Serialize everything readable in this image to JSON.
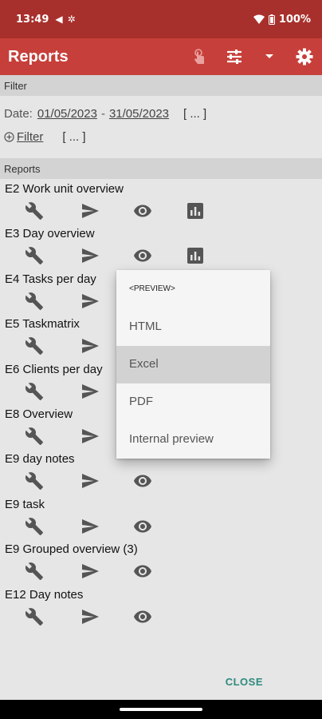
{
  "status_bar": {
    "time": "13:49",
    "battery": "100%"
  },
  "app_bar": {
    "title": "Reports"
  },
  "filter_section": {
    "header": "Filter",
    "date_label": "Date:",
    "date_from": "01/05/2023",
    "separator": "-",
    "date_to": "31/05/2023",
    "date_more": "[ ... ]",
    "filter_label": "Filter",
    "filter_more": "[ ... ]"
  },
  "reports_section": {
    "header": "Reports",
    "items": [
      {
        "name": "E2 Work unit overview"
      },
      {
        "name": "E3 Day overview"
      },
      {
        "name": "E4 Tasks per day"
      },
      {
        "name": "E5 Taskmatrix"
      },
      {
        "name": "E6 Clients per day"
      },
      {
        "name": "E8 Overview"
      },
      {
        "name": "E9 day notes"
      },
      {
        "name": "E9 task"
      },
      {
        "name": "E9 Grouped overview (3)"
      },
      {
        "name": "E12 Day notes"
      }
    ]
  },
  "preview_menu": {
    "header": "<PREVIEW>",
    "items": [
      "HTML",
      "Excel",
      "PDF",
      "Internal preview"
    ],
    "selected": "Excel"
  },
  "close_label": "CLOSE",
  "icons": {
    "configure": "wrench-icon",
    "send": "send-icon",
    "preview": "eye-icon",
    "chart": "bar-chart-icon",
    "add": "plus-circle-icon",
    "settings": "gear-icon",
    "sort": "sliders-icon",
    "dropdown": "caret-down-icon",
    "touch": "touch-icon"
  },
  "colors": {
    "status_bar": "#a8302c",
    "app_bar": "#c73f3a",
    "accent": "#2e8a7e"
  }
}
